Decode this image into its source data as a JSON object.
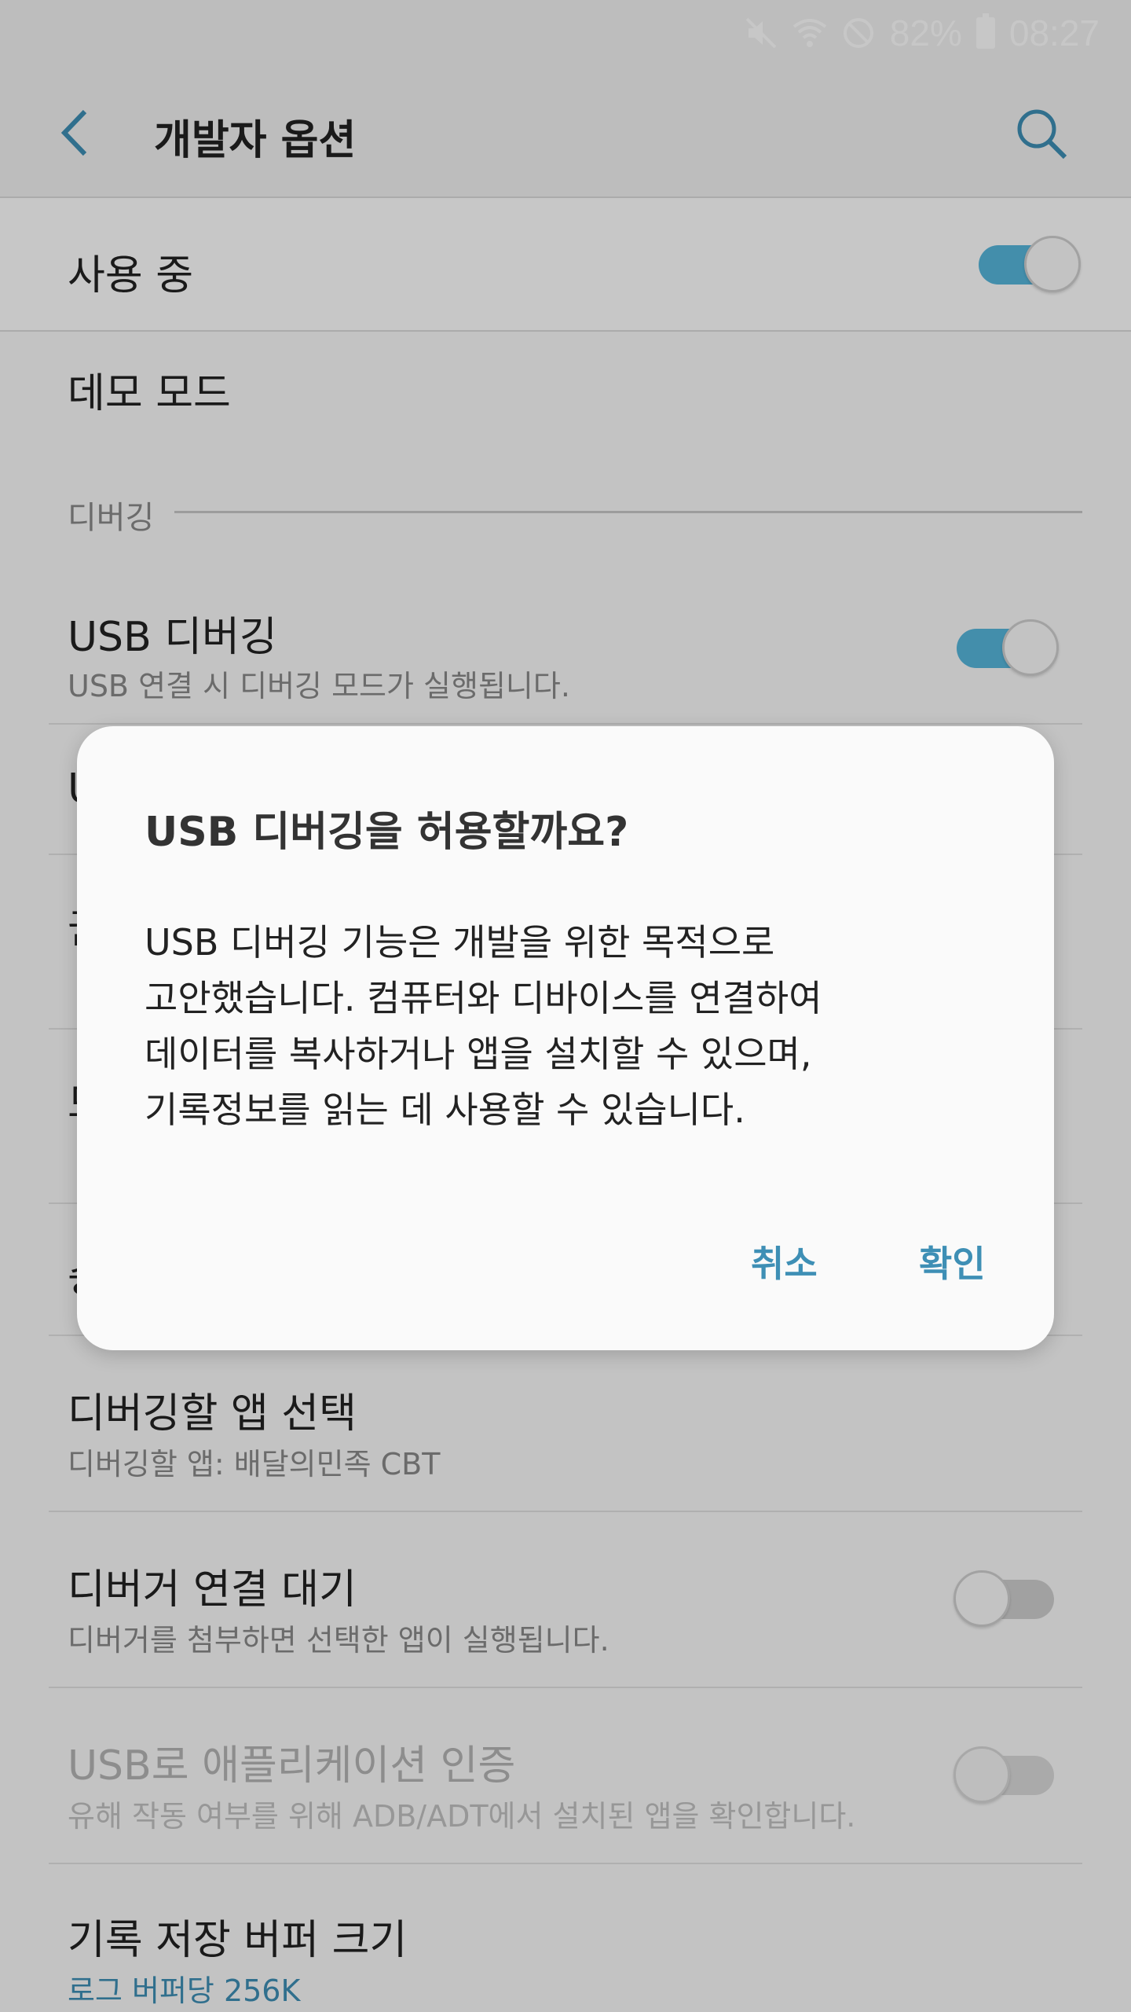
{
  "status_bar": {
    "battery_percent": "82%",
    "time": "08:27",
    "icons": [
      "mute-icon",
      "wifi-icon",
      "do-not-disturb-icon",
      "battery-icon"
    ]
  },
  "app_bar": {
    "title": "개발자 옵션",
    "back_icon": "chevron-left-icon",
    "search_icon": "search-icon"
  },
  "master_switch": {
    "label": "사용 중",
    "on": true
  },
  "list": {
    "demo_mode": {
      "title": "데모 모드"
    },
    "section_debugging": "디버깅",
    "usb_debugging": {
      "title": "USB 디버깅",
      "subtitle": "USB 연결 시 디버깅 모드가 실행됩니다.",
      "on": true
    },
    "partial_rows": [
      "U",
      "권",
      "모",
      "승"
    ],
    "select_debug_app": {
      "title": "디버깅할 앱 선택",
      "subtitle": "디버깅할 앱: 배달의민족 CBT"
    },
    "wait_for_debugger": {
      "title": "디버거 연결 대기",
      "subtitle": "디버거를 첨부하면 선택한 앱이 실행됩니다.",
      "on": false
    },
    "verify_apps_usb": {
      "title": "USB로 애플리케이션 인증",
      "subtitle": "유해 작동 여부를 위해 ADB/ADT에서 설치된 앱을 확인합니다.",
      "on": false,
      "enabled": false
    },
    "logger_buffer": {
      "title": "기록 저장 버퍼 크기",
      "subtitle": "로그 버퍼당 256K"
    }
  },
  "dialog": {
    "title": "USB 디버깅을 허용할까요?",
    "body_lines": [
      "USB 디버깅 기능은 개발을 위한 목적으로",
      "고안했습니다. 컴퓨터와 디바이스를 연결하여",
      "데이터를 복사하거나 앱을 설치할 수 있으며,",
      "기록정보를 읽는 데 사용할 수 있습니다."
    ],
    "cancel_label": "취소",
    "ok_label": "확인"
  },
  "colors": {
    "accent": "#3e8fb5",
    "switch_on": "#56b6dc",
    "scrim": "rgba(0,0,0,0.22)"
  }
}
